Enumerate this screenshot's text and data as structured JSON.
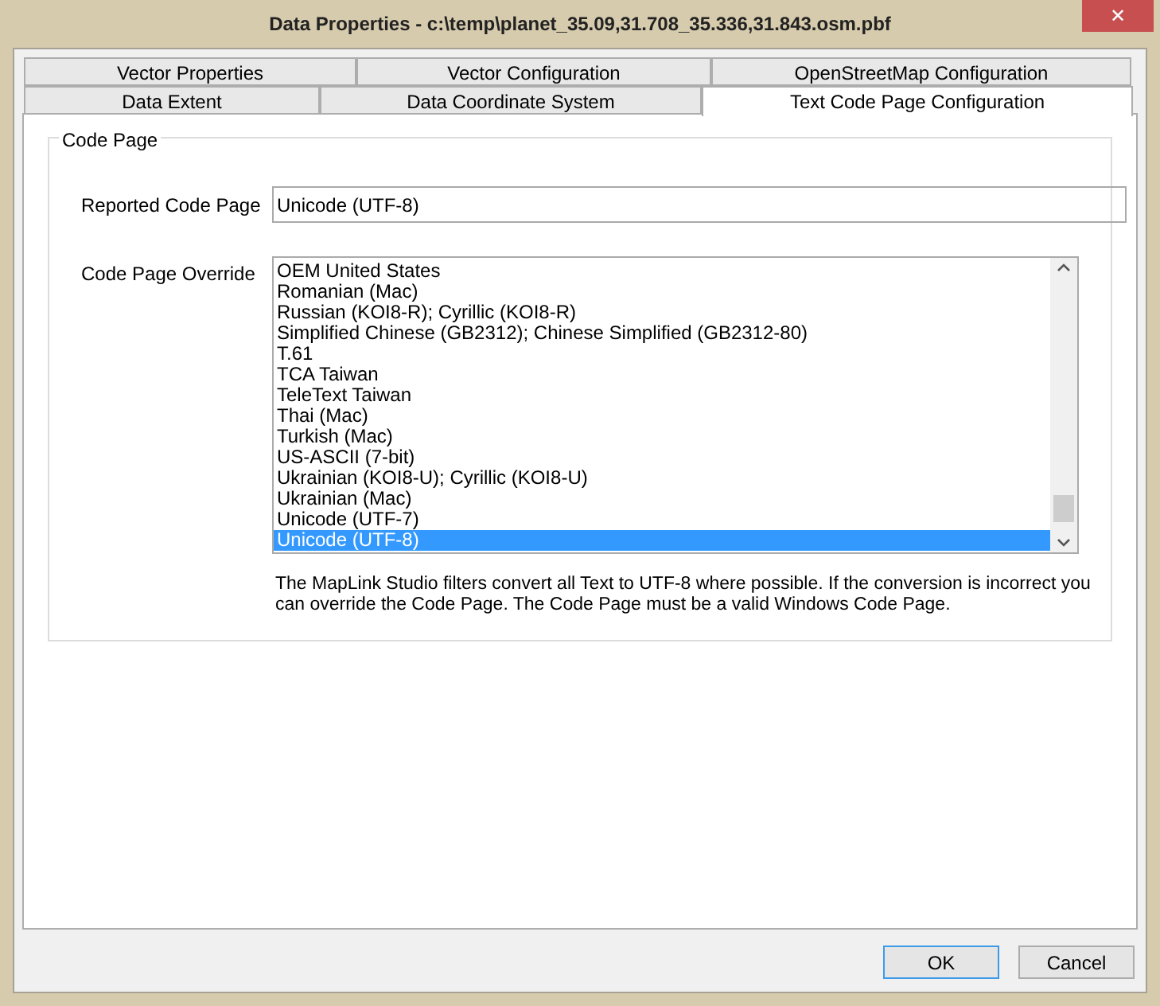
{
  "window": {
    "title": "Data Properties - c:\\temp\\planet_35.09,31.708_35.336,31.843.osm.pbf",
    "close": "✕"
  },
  "tab_rows": [
    [
      {
        "label": "Vector Properties",
        "selected": false
      },
      {
        "label": "Vector Configuration",
        "selected": false
      },
      {
        "label": "OpenStreetMap Configuration",
        "selected": false
      }
    ],
    [
      {
        "label": "Data Extent",
        "selected": false
      },
      {
        "label": "Data Coordinate System",
        "selected": false
      },
      {
        "label": "Text Code Page Configuration",
        "selected": true
      }
    ]
  ],
  "group": {
    "title": "Code Page",
    "reported": {
      "label": "Reported Code Page",
      "value": "Unicode (UTF-8)"
    },
    "override": {
      "label": "Code Page Override",
      "items": [
        {
          "label": "OEM United States",
          "selected": false
        },
        {
          "label": "Romanian (Mac)",
          "selected": false
        },
        {
          "label": "Russian (KOI8-R); Cyrillic (KOI8-R)",
          "selected": false
        },
        {
          "label": "Simplified Chinese (GB2312); Chinese Simplified (GB2312-80)",
          "selected": false
        },
        {
          "label": "T.61",
          "selected": false
        },
        {
          "label": "TCA Taiwan",
          "selected": false
        },
        {
          "label": "TeleText Taiwan",
          "selected": false
        },
        {
          "label": "Thai (Mac)",
          "selected": false
        },
        {
          "label": "Turkish (Mac)",
          "selected": false
        },
        {
          "label": "US-ASCII (7-bit)",
          "selected": false
        },
        {
          "label": "Ukrainian (KOI8-U); Cyrillic (KOI8-U)",
          "selected": false
        },
        {
          "label": "Ukrainian (Mac)",
          "selected": false
        },
        {
          "label": "Unicode (UTF-7)",
          "selected": false
        },
        {
          "label": "Unicode (UTF-8)",
          "selected": true
        }
      ]
    },
    "note": "The MapLink Studio filters convert all Text to UTF-8 where possible. If the conversion is incorrect you can override the Code Page. The Code Page must be a valid Windows Code Page."
  },
  "buttons": [
    {
      "label": "OK",
      "kind": "default"
    },
    {
      "label": "Cancel",
      "kind": "normal"
    }
  ]
}
